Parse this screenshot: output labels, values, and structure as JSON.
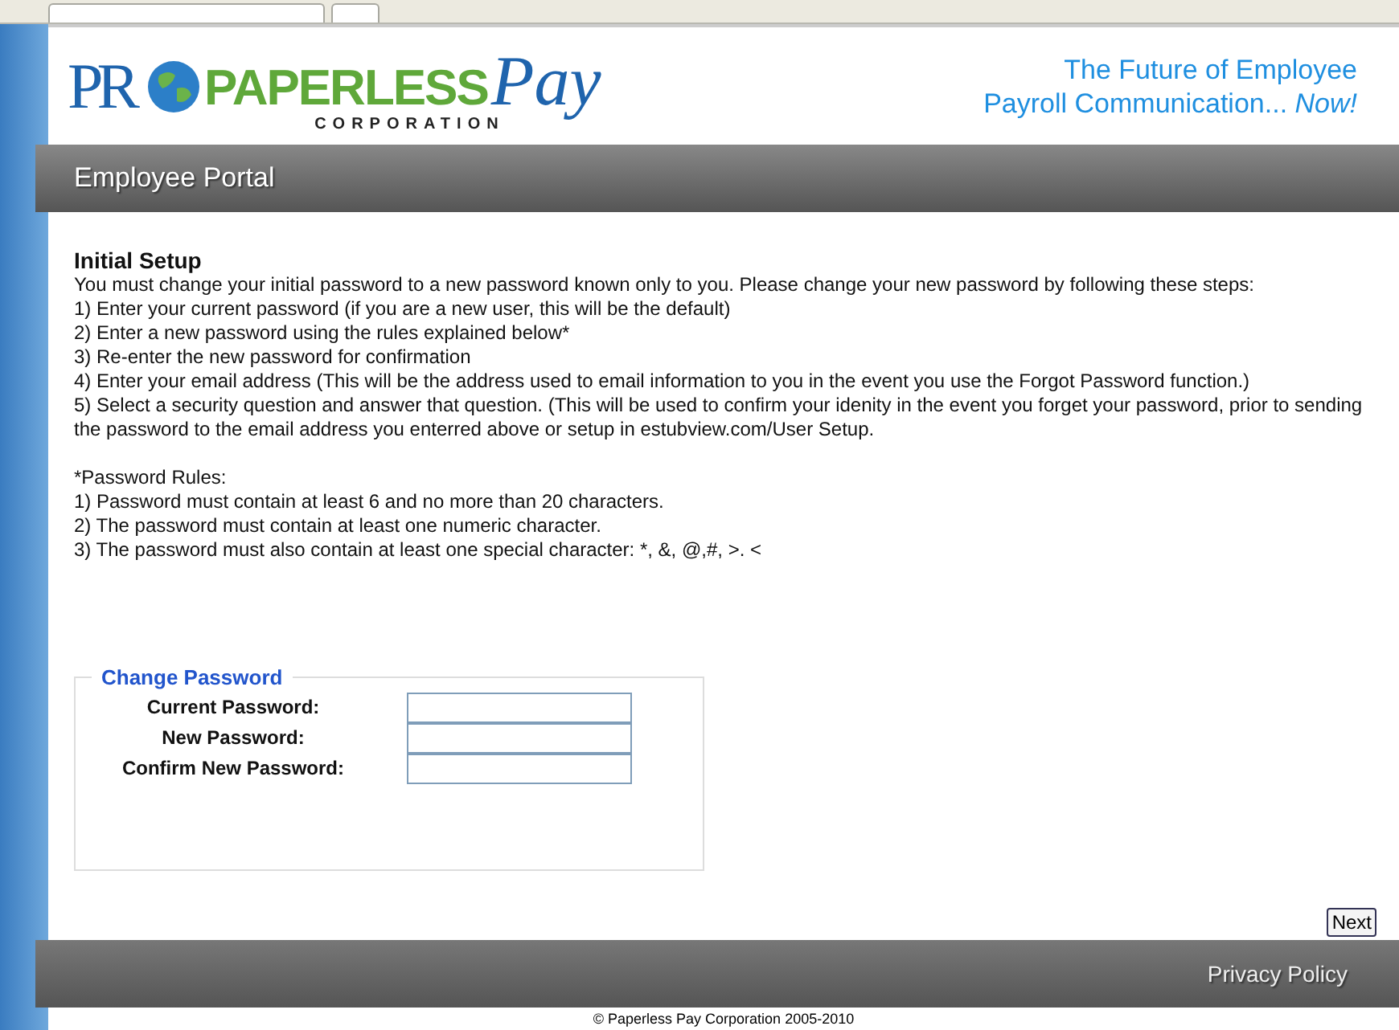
{
  "logo": {
    "mark": "PR",
    "name": "PAPERLESS",
    "script": "Pay",
    "subtitle": "CORPORATION"
  },
  "tagline": [
    "The Future of Employee",
    "Payroll Communication... *Now!*"
  ],
  "portal_bar": {
    "title": "Employee Portal"
  },
  "intro": {
    "heading": "Initial Setup",
    "lines": [
      "You must change your initial password to a new password known only to you. Please change your new password by following these steps:",
      "1) Enter your current password (if you are a new user, this will be the default)",
      "2) Enter a new password using the rules explained below*",
      "3) Re-enter the new password for confirmation",
      "4) Enter your email address (This will be the address used to email information to you in the event you use the Forgot Password function.)",
      "5) Select a security question and answer that question. (This will be used to confirm your idenity in the event you forget your password, prior to sending the password to the email address you enterred above or setup in estubview.com/User Setup."
    ]
  },
  "rules": {
    "heading": "*Password Rules:",
    "lines": [
      "1) Password must contain at least 6 and no more than 20 characters.",
      "2) The password must contain at least one numeric character.",
      "3) The password must also contain at least one special character: *, &, @,#, >. <"
    ]
  },
  "change_password": {
    "legend": "Change Password",
    "fields": [
      {
        "label": "Current Password:"
      },
      {
        "label": "New Password:"
      },
      {
        "label": "Confirm New Password:"
      }
    ]
  },
  "next_button": "Next",
  "footer": {
    "link": "Privacy Policy",
    "copyright": "© Paperless Pay Corporation 2005-2010"
  }
}
